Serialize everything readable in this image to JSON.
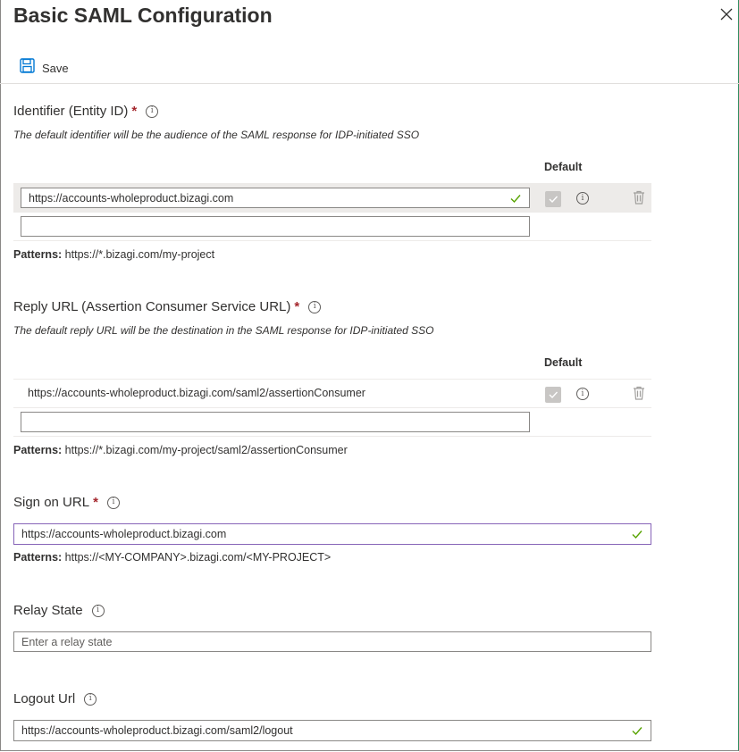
{
  "header": {
    "title": "Basic SAML Configuration"
  },
  "toolbar": {
    "save_label": "Save"
  },
  "common": {
    "required_mark": "*",
    "default_col": "Default",
    "patterns_label": "Patterns:"
  },
  "identifier": {
    "label": "Identifier (Entity ID)",
    "description": "The default identifier will be the audience of the SAML response for IDP-initiated SSO",
    "value": "https://accounts-wholeproduct.bizagi.com",
    "new_value": "",
    "patterns": "https://*.bizagi.com/my-project"
  },
  "reply_url": {
    "label": "Reply URL (Assertion Consumer Service URL)",
    "description": "The default reply URL will be the destination in the SAML response for IDP-initiated SSO",
    "value": "https://accounts-wholeproduct.bizagi.com/saml2/assertionConsumer",
    "new_value": "",
    "patterns": "https://*.bizagi.com/my-project/saml2/assertionConsumer"
  },
  "sign_on_url": {
    "label": "Sign on URL",
    "value": "https://accounts-wholeproduct.bizagi.com",
    "patterns": "https://<MY-COMPANY>.bizagi.com/<MY-PROJECT>"
  },
  "relay_state": {
    "label": "Relay State",
    "placeholder": "Enter a relay state"
  },
  "logout_url": {
    "label": "Logout Url",
    "value": "https://accounts-wholeproduct.bizagi.com/saml2/logout"
  },
  "colors": {
    "accent": "#0078d4",
    "valid": "#57a300",
    "required": "#a4262c",
    "focus_border": "#8764b8"
  },
  "icons": [
    "close-icon",
    "save-icon",
    "info-icon",
    "checkmark-icon",
    "checkbox-icon",
    "trash-icon"
  ]
}
